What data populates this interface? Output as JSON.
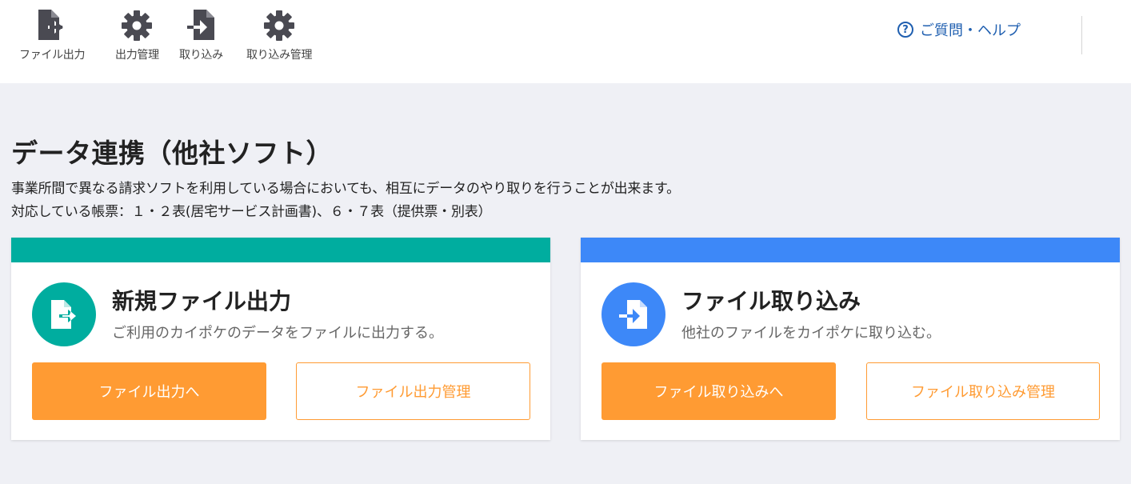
{
  "toolbar": {
    "items": [
      {
        "label": "ファイル出力",
        "icon": "file-export-icon"
      },
      {
        "label": "出力管理",
        "icon": "gear-icon"
      },
      {
        "label": "取り込み",
        "icon": "file-import-icon"
      },
      {
        "label": "取り込み管理",
        "icon": "gear-icon"
      }
    ],
    "help_label": "ご質問・ヘルプ",
    "help_icon_glyph": "?"
  },
  "page": {
    "title": "データ連携（他社ソフト）",
    "description_line1": "事業所間で異なる請求ソフトを利用している場合においても、相互にデータのやり取りを行うことが出来ます。",
    "description_line2": "対応している帳票：１・２表(居宅サービス計画書)、６・７表（提供票・別表）"
  },
  "cards": {
    "export": {
      "title": "新規ファイル出力",
      "subtitle": "ご利用のカイポケのデータをファイルに出力する。",
      "primary_button": "ファイル出力へ",
      "secondary_button": "ファイル出力管理",
      "accent_color": "#00ad9f",
      "icon": "file-export-icon"
    },
    "import": {
      "title": "ファイル取り込み",
      "subtitle": "他社のファイルをカイポケに取り込む。",
      "primary_button": "ファイル取り込みへ",
      "secondary_button": "ファイル取り込み管理",
      "accent_color": "#3d88f8",
      "icon": "file-import-icon"
    }
  },
  "colors": {
    "button_orange": "#ff9b33",
    "help_blue": "#1f5fb0",
    "toolbar_icon": "#4a4a52",
    "background": "#eff0f5"
  }
}
